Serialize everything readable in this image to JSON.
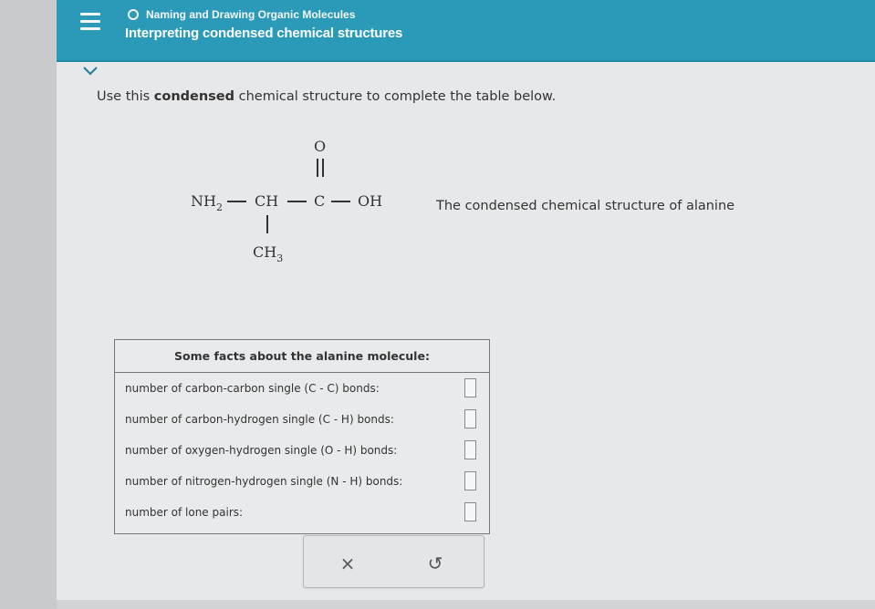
{
  "header": {
    "topic": "Naming and Drawing Organic Molecules",
    "title": "Interpreting condensed chemical structures"
  },
  "question": {
    "prefix": "Use this ",
    "bold": "condensed",
    "suffix": " chemical structure to complete the table below."
  },
  "molecule": {
    "nh2": "NH",
    "nh2_sub": "2",
    "ch": "CH",
    "c": "C",
    "oh": "OH",
    "o": "O",
    "ch3": "CH",
    "ch3_sub": "3"
  },
  "caption": "The condensed chemical structure of alanine",
  "table": {
    "heading": "Some facts about the alanine molecule:",
    "rows": [
      {
        "label": "number of carbon-carbon single (C - C) bonds:",
        "value": ""
      },
      {
        "label": "number of carbon-hydrogen single (C - H) bonds:",
        "value": ""
      },
      {
        "label": "number of oxygen-hydrogen single (O - H) bonds:",
        "value": ""
      },
      {
        "label": "number of nitrogen-hydrogen single (N - H) bonds:",
        "value": ""
      },
      {
        "label": "number of lone pairs:",
        "value": ""
      }
    ]
  },
  "actions": {
    "clear": "×",
    "undo": "↺"
  },
  "colors": {
    "header": "#2a9ab8",
    "background": "#e7e8ea"
  },
  "icons": {
    "menu": "hamburger-icon",
    "collapse": "chevron-down-icon",
    "topic": "circle-icon",
    "clear": "close-icon",
    "undo": "undo-icon"
  }
}
